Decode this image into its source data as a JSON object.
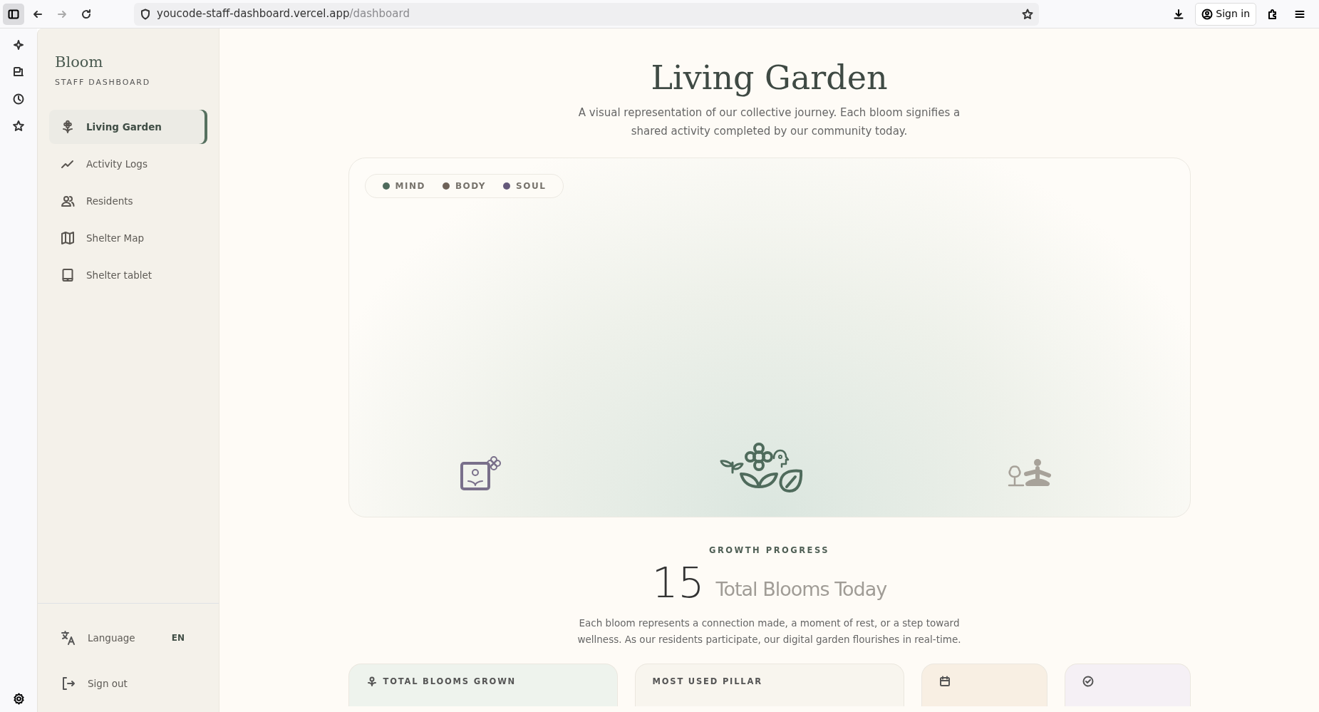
{
  "browser": {
    "url_host": "youcode-staff-dashboard.vercel.app",
    "url_path": "/dashboard",
    "sign_in": "Sign in"
  },
  "sidebar": {
    "brand": "Bloom",
    "subtitle": "STAFF DASHBOARD",
    "nav": [
      {
        "label": "Living Garden",
        "kind": "flower",
        "selected": true
      },
      {
        "label": "Activity Logs",
        "kind": "trend",
        "selected": false
      },
      {
        "label": "Residents",
        "kind": "users",
        "selected": false
      },
      {
        "label": "Shelter Map",
        "kind": "map",
        "selected": false
      },
      {
        "label": "Shelter tablet",
        "kind": "tablet",
        "selected": false
      }
    ],
    "language": {
      "label": "Language",
      "value": "EN"
    },
    "sign_out": "Sign out"
  },
  "hero": {
    "title": "Living Garden",
    "description": "A visual representation of our collective journey. Each bloom signifies a shared activity completed by our community today."
  },
  "garden": {
    "legend": [
      {
        "label": "MIND",
        "color": "#4f6b5c"
      },
      {
        "label": "BODY",
        "color": "#6e6258"
      },
      {
        "label": "SOUL",
        "color": "#65597a"
      }
    ]
  },
  "growth": {
    "eyebrow": "GROWTH PROGRESS",
    "count": "15",
    "count_label": "Total Blooms Today",
    "description": "Each bloom represents a connection made, a moment of rest, or a step toward wellness. As our residents participate, our digital garden flourishes in real-time."
  },
  "stat_cards": [
    {
      "kind": "flower",
      "label": "TOTAL BLOOMS GROWN",
      "color": "#eef3ed"
    },
    {
      "kind": "text",
      "label": "MOST USED PILLAR",
      "color": "#f8f5ee"
    },
    {
      "kind": "calendar",
      "color": "#f8efe3"
    },
    {
      "kind": "check",
      "color": "#f5f0f5"
    }
  ]
}
